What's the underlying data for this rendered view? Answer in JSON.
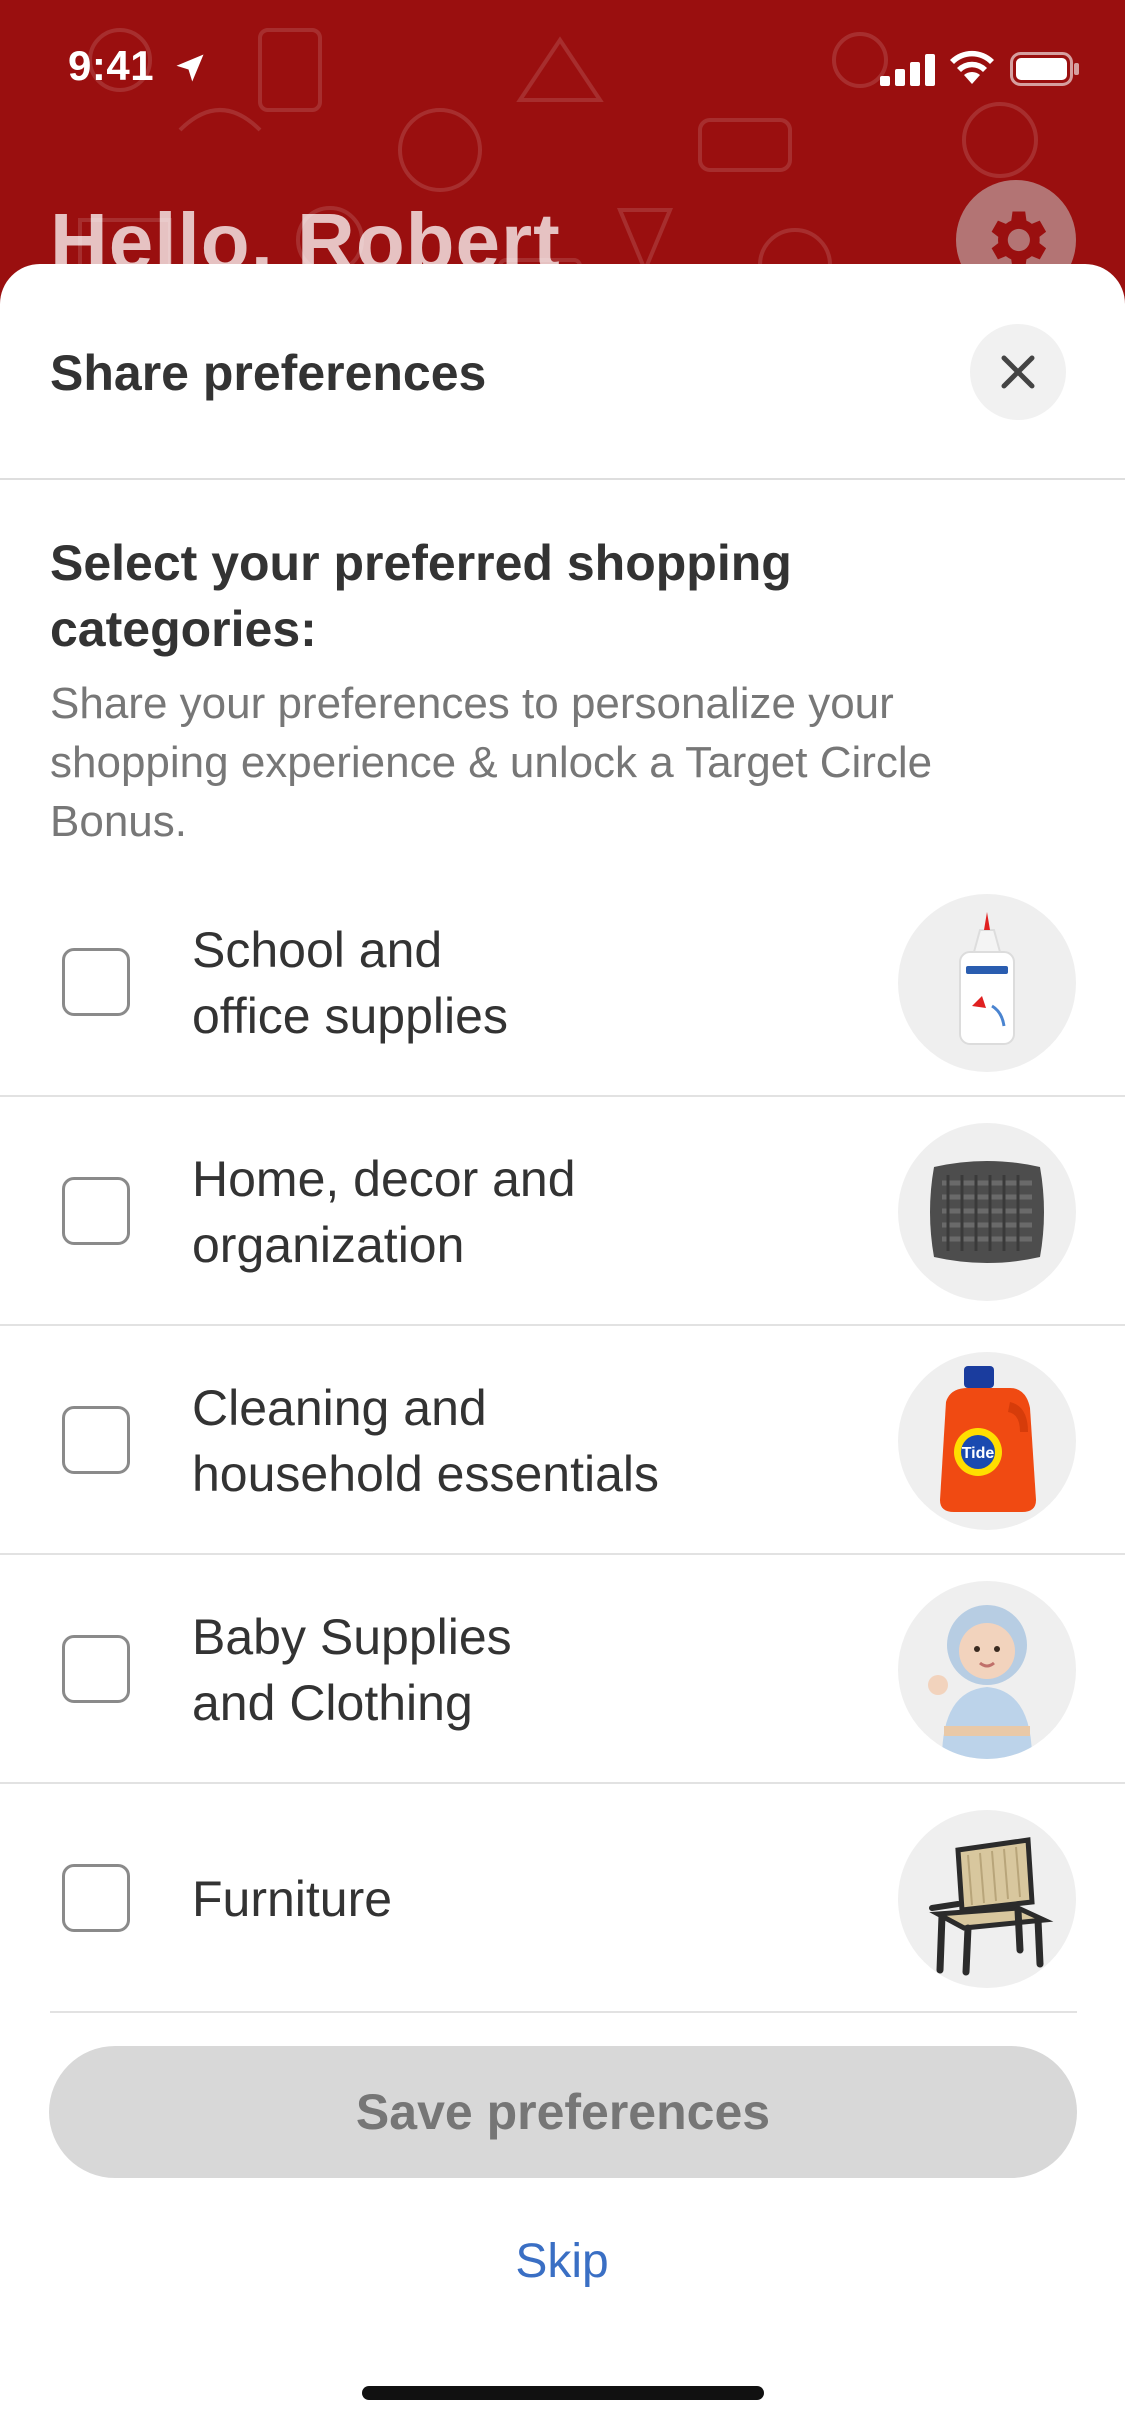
{
  "status_bar": {
    "time": "9:41",
    "icons": [
      "location-arrow-icon",
      "cellular-signal-icon",
      "wifi-icon",
      "battery-icon"
    ]
  },
  "background": {
    "greeting": "Hello, Robert",
    "settings_icon": "gear-icon",
    "brand_color": "#9a0f0f"
  },
  "sheet": {
    "title": "Share preferences",
    "close_icon": "close-icon",
    "heading": "Select your preferred shopping categories:",
    "description": "Share your preferences to personalize your shopping experience & unlock a Target Circle Bonus.",
    "categories": [
      {
        "label": "School and\noffice supplies",
        "checked": false,
        "image": "school-glue-image"
      },
      {
        "label": "Home, decor and\norganization",
        "checked": false,
        "image": "knit-pillow-image"
      },
      {
        "label": "Cleaning and\nhousehold essentials",
        "checked": false,
        "image": "detergent-bottle-image"
      },
      {
        "label": "Baby Supplies\nand Clothing",
        "checked": false,
        "image": "baby-image"
      },
      {
        "label": "Furniture",
        "checked": false,
        "image": "chair-image"
      }
    ],
    "save_label": "Save preferences",
    "save_enabled": false,
    "skip_label": "Skip",
    "link_color": "#3a6fc4"
  }
}
